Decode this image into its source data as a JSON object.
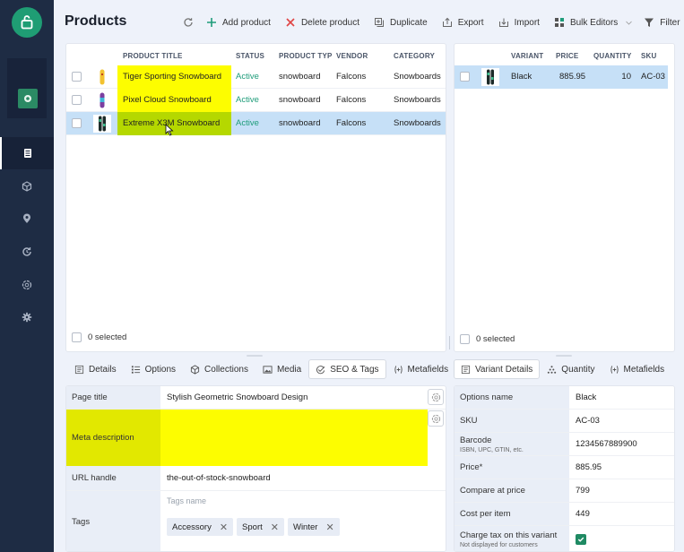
{
  "app": {
    "title": "Products"
  },
  "sidebar": {
    "logo_icon": "shopping-bag-icon",
    "store_icon": "store-icon",
    "items": [
      {
        "icon": "document-icon",
        "active": true
      },
      {
        "icon": "cube-icon",
        "active": false
      },
      {
        "icon": "location-pin-icon",
        "active": false
      },
      {
        "icon": "refresh-clock-icon",
        "active": false
      },
      {
        "icon": "openai-icon",
        "active": false
      },
      {
        "icon": "gear-icon",
        "active": false
      }
    ]
  },
  "toolbar": {
    "refresh_icon": "refresh-icon",
    "add_product": "Add product",
    "delete_product": "Delete product",
    "duplicate": "Duplicate",
    "export": "Export",
    "import": "Import",
    "bulk_editors": "Bulk Editors",
    "filter": "Filter"
  },
  "products": {
    "columns": [
      "PRODUCT TITLE",
      "STATUS",
      "PRODUCT TYP",
      "VENDOR",
      "CATEGORY"
    ],
    "rows": [
      {
        "title": "Tiger Sporting Snowboard",
        "status": "Active",
        "type": "snowboard",
        "vendor": "Falcons",
        "category": "Snowboards",
        "selected": false
      },
      {
        "title": "Pixel Cloud Snowboard",
        "status": "Active",
        "type": "snowboard",
        "vendor": "Falcons",
        "category": "Snowboards",
        "selected": false
      },
      {
        "title": "Extreme X3M Snowboard",
        "status": "Active",
        "type": "snowboard",
        "vendor": "Falcons",
        "category": "Snowboards",
        "selected": true
      }
    ],
    "selected_count": "0 selected"
  },
  "variants": {
    "columns": [
      "VARIANT",
      "PRICE",
      "QUANTITY",
      "SKU"
    ],
    "rows": [
      {
        "variant": "Black",
        "price": "885.95",
        "quantity": "10",
        "sku": "AC-03",
        "selected": true
      }
    ],
    "selected_count": "0 selected"
  },
  "product_tabs": [
    {
      "label": "Details",
      "icon": "details-icon",
      "active": false
    },
    {
      "label": "Options",
      "icon": "list-icon",
      "active": false
    },
    {
      "label": "Collections",
      "icon": "cube-icon",
      "active": false
    },
    {
      "label": "Media",
      "icon": "image-icon",
      "active": false
    },
    {
      "label": "SEO & Tags",
      "icon": "seo-check-icon",
      "active": true
    },
    {
      "label": "Metafields",
      "icon": "metafields-icon",
      "active": false
    }
  ],
  "variant_tabs": [
    {
      "label": "Variant Details",
      "icon": "details-icon",
      "active": true
    },
    {
      "label": "Quantity",
      "icon": "quantity-icon",
      "active": false
    },
    {
      "label": "Metafields",
      "icon": "metafields-icon",
      "active": false
    }
  ],
  "seo": {
    "page_title_label": "Page title",
    "page_title_value": "Stylish Geometric Snowboard Design",
    "meta_description_label": "Meta description",
    "meta_description_value": "",
    "url_handle_label": "URL handle",
    "url_handle_value": "the-out-of-stock-snowboard",
    "tags_label": "Tags",
    "tags_placeholder": "Tags name",
    "tags": [
      "Accessory",
      "Sport",
      "Winter"
    ]
  },
  "variant_details": {
    "fields": [
      {
        "label": "Options name",
        "sub": "",
        "value": "Black"
      },
      {
        "label": "SKU",
        "sub": "",
        "value": "AC-03"
      },
      {
        "label": "Barcode",
        "sub": "ISBN, UPC, GTIN, etc.",
        "value": "1234567889900"
      },
      {
        "label": "Price*",
        "sub": "",
        "value": "885.95"
      },
      {
        "label": "Compare at price",
        "sub": "",
        "value": "799"
      },
      {
        "label": "Cost per item",
        "sub": "",
        "value": "449"
      },
      {
        "label": "Charge tax on this variant",
        "sub": "Not displayed for customers",
        "value": "",
        "checked": true
      }
    ]
  },
  "colors": {
    "sidebar": "#1e2c44",
    "accent": "#1f9d74",
    "highlight_yellow": "#fdfd00",
    "highlight_green": "#b5d800",
    "selected_row": "#c6e0f7",
    "status_active": "#1e9c7a"
  }
}
